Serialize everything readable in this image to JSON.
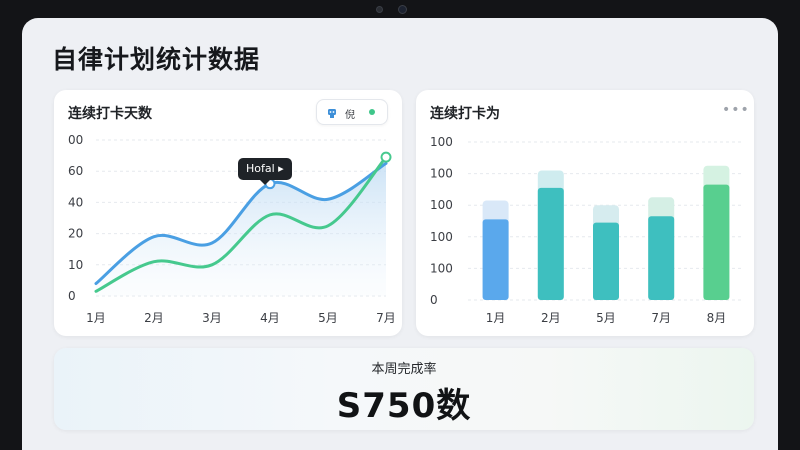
{
  "page": {
    "title": "自律计划统计数据"
  },
  "left_card": {
    "title": "连续打卡天数",
    "legend": {
      "text": "倪"
    },
    "tooltip": "Hofal ▸"
  },
  "right_card": {
    "title": "连续打卡为",
    "more": "•••"
  },
  "bottom_card": {
    "label": "本周完成率",
    "value": "S750数"
  },
  "colors": {
    "blue": "#4a9fe3",
    "green": "#46c98e",
    "bar_blue": "#5aa8ec",
    "bar_teal": "#3ebfbf",
    "bar_green": "#58cf8f"
  },
  "chart_data": [
    {
      "type": "line",
      "y_tick_labels": [
        "00",
        "60",
        "40",
        "20",
        "10",
        "0"
      ],
      "categories": [
        "1月",
        "2月",
        "3月",
        "4月",
        "5月",
        "7月"
      ],
      "ylim": [
        0,
        100
      ],
      "series": [
        {
          "values": [
            8,
            38,
            34,
            72,
            62,
            85
          ],
          "peak_index": 3
        },
        {
          "values": [
            3,
            22,
            20,
            52,
            45,
            89
          ],
          "end_marker": true
        }
      ]
    },
    {
      "type": "bar",
      "y_tick_labels": [
        "100",
        "100",
        "100",
        "100",
        "100",
        "0"
      ],
      "categories": [
        "1月",
        "2月",
        "5月",
        "7月",
        "8月"
      ],
      "ylim": [
        0,
        100
      ],
      "values": [
        51,
        71,
        49,
        53,
        73
      ],
      "background_values": [
        63,
        82,
        60,
        65,
        85
      ]
    }
  ]
}
